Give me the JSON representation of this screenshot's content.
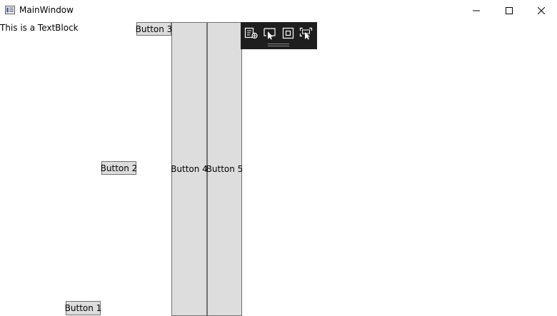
{
  "window": {
    "title": "MainWindow",
    "controls": {
      "minimize": "minimize-icon",
      "maximize": "maximize-icon",
      "close": "close-icon"
    }
  },
  "content": {
    "textblock": "This is a TextBlock",
    "buttons": {
      "b1": "Button 1",
      "b2": "Button 2",
      "b3": "Button 3",
      "b4": "Button 4",
      "b5": "Button 5"
    }
  },
  "debug_toolbar": {
    "tools": [
      "live-visual-tree-icon",
      "select-element-icon",
      "display-layout-adorners-icon",
      "track-focused-element-icon"
    ]
  },
  "colors": {
    "button_face": "#dddddd",
    "button_border": "#707070",
    "toolbar_bg": "#1e1e1e"
  }
}
